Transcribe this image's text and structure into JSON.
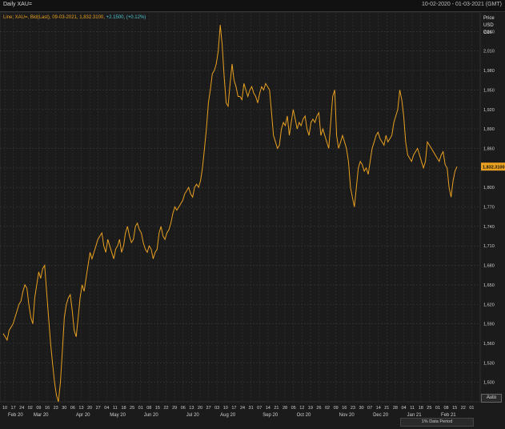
{
  "header": {
    "title": "Daily XAU=",
    "date_range": "10-02-2020 - 01-03-2021 (GMT)"
  },
  "legend": {
    "prefix": "Line; XAU=, Bid(Last), 09-03-2021, 1,832.3100, ",
    "change": "+2.1500, (+0.12%)"
  },
  "axis_header": {
    "line1": "Price",
    "line2": "USD",
    "line3": "Ozs"
  },
  "auto_button": "Auto",
  "data_period": "1% Data Period",
  "colors": {
    "background": "#1b1b1b",
    "grid": "#3a3a3a",
    "series": "#e8a020",
    "change_text": "#4fc3d0",
    "last_value_badge": "#e8a020"
  },
  "chart_data": {
    "type": "line",
    "title": "Daily XAU=",
    "ylabel": "Price USD Ozs",
    "ylim": [
      1470,
      2070
    ],
    "last_value_label": "1,832.3100",
    "yticks": [
      1500,
      1530,
      1560,
      1590,
      1620,
      1650,
      1680,
      1710,
      1740,
      1770,
      1800,
      1830,
      1860,
      1890,
      1920,
      1950,
      1980,
      2010,
      2040
    ],
    "ytick_labels": [
      "1,500",
      "1,530",
      "1,560",
      "1,590",
      "1,620",
      "1,650",
      "1,680",
      "1,710",
      "1,740",
      "1,770",
      "1,800",
      "1,830",
      "1,860",
      "1,890",
      "1,920",
      "1,950",
      "1,980",
      "2,010",
      "2,040"
    ],
    "xticks_day": [
      "10",
      "17",
      "24",
      "02",
      "09",
      "16",
      "23",
      "30",
      "06",
      "13",
      "20",
      "27",
      "04",
      "11",
      "18",
      "25",
      "01",
      "08",
      "15",
      "22",
      "29",
      "06",
      "13",
      "20",
      "27",
      "03",
      "10",
      "17",
      "24",
      "31",
      "07",
      "14",
      "21",
      "28",
      "05",
      "12",
      "19",
      "26",
      "02",
      "09",
      "16",
      "23",
      "30",
      "07",
      "14",
      "21",
      "28",
      "04",
      "11",
      "18",
      "25",
      "01",
      "08",
      "15",
      "22",
      "01"
    ],
    "xticks_month": [
      "Feb 20",
      "Mar 20",
      "Apr 20",
      "May 20",
      "Jun 20",
      "Jul 20",
      "Aug 20",
      "Sep 20",
      "Oct 20",
      "Nov 20",
      "Dec 20",
      "Jan 21",
      "Feb 21"
    ],
    "month_tick_index": [
      0,
      3,
      8,
      12,
      16,
      21,
      25,
      30,
      34,
      39,
      43,
      47,
      51
    ],
    "series": [
      {
        "values": [
          1575,
          1570,
          1565,
          1580,
          1585,
          1590,
          1600,
          1610,
          1620,
          1625,
          1640,
          1650,
          1645,
          1620,
          1600,
          1590,
          1630,
          1650,
          1670,
          1660,
          1675,
          1680,
          1640,
          1600,
          1560,
          1530,
          1500,
          1480,
          1470,
          1500,
          1550,
          1600,
          1620,
          1630,
          1635,
          1610,
          1580,
          1570,
          1600,
          1630,
          1650,
          1640,
          1660,
          1680,
          1700,
          1690,
          1700,
          1710,
          1720,
          1725,
          1730,
          1710,
          1700,
          1720,
          1710,
          1700,
          1690,
          1705,
          1710,
          1720,
          1700,
          1710,
          1730,
          1740,
          1725,
          1715,
          1720,
          1740,
          1745,
          1735,
          1730,
          1715,
          1705,
          1700,
          1710,
          1705,
          1690,
          1700,
          1705,
          1730,
          1740,
          1725,
          1720,
          1730,
          1735,
          1745,
          1760,
          1770,
          1765,
          1770,
          1775,
          1780,
          1790,
          1795,
          1800,
          1790,
          1785,
          1800,
          1805,
          1800,
          1810,
          1830,
          1860,
          1890,
          1930,
          1950,
          1975,
          1980,
          1990,
          2010,
          2050,
          2020,
          1970,
          1930,
          1925,
          1960,
          1990,
          1965,
          1955,
          1940,
          1940,
          1935,
          1960,
          1950,
          1940,
          1950,
          1955,
          1945,
          1940,
          1930,
          1945,
          1955,
          1950,
          1960,
          1955,
          1950,
          1915,
          1880,
          1870,
          1860,
          1865,
          1890,
          1900,
          1895,
          1910,
          1880,
          1900,
          1920,
          1905,
          1890,
          1900,
          1895,
          1905,
          1910,
          1890,
          1880,
          1900,
          1905,
          1900,
          1910,
          1915,
          1880,
          1890,
          1880,
          1870,
          1860,
          1900,
          1940,
          1950,
          1880,
          1860,
          1870,
          1880,
          1870,
          1860,
          1840,
          1800,
          1785,
          1770,
          1800,
          1830,
          1840,
          1835,
          1825,
          1830,
          1820,
          1840,
          1860,
          1870,
          1880,
          1885,
          1875,
          1870,
          1865,
          1880,
          1870,
          1875,
          1880,
          1900,
          1910,
          1920,
          1950,
          1935,
          1910,
          1870,
          1850,
          1845,
          1840,
          1850,
          1855,
          1860,
          1850,
          1840,
          1830,
          1840,
          1870,
          1865,
          1860,
          1855,
          1850,
          1845,
          1840,
          1850,
          1855,
          1835,
          1830,
          1800,
          1785,
          1810,
          1825,
          1832
        ]
      }
    ],
    "grid": true
  }
}
